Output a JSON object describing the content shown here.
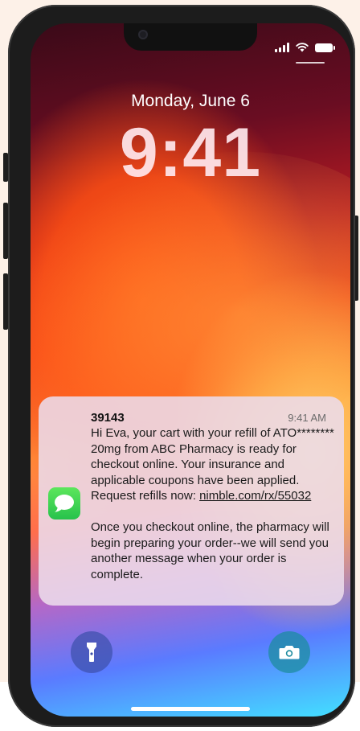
{
  "status_bar": {
    "icons": [
      "signal-icon",
      "wifi-icon",
      "battery-icon"
    ]
  },
  "lock_screen": {
    "date": "Monday, June 6",
    "time": "9:41"
  },
  "notification": {
    "app_icon": "messages-icon",
    "sender": "39143",
    "time": "9:41 AM",
    "message_line_1": "Hi Eva, your cart with your refill of ATO******** 20mg from ABC Pharmacy is ready for checkout online. Your insurance and applicable coupons have been applied. Request refills now: ",
    "link": "nimble.com/rx/55032",
    "message_line_2": "Once you checkout online, the pharmacy will begin preparing your order--we will send you another message when your order is complete."
  },
  "controls": {
    "flashlight_icon": "flashlight-icon",
    "camera_icon": "camera-icon"
  },
  "colors": {
    "accent_green": "#34c759",
    "background": "#fdf1e8"
  }
}
